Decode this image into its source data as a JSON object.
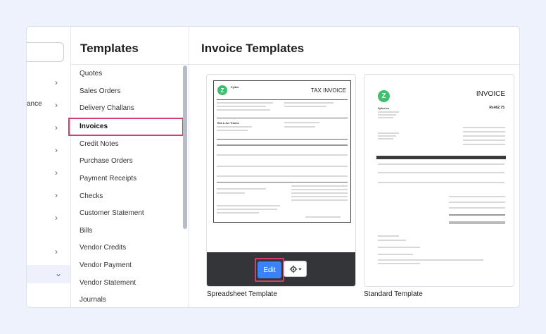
{
  "left_nav": {
    "fragment": "ance"
  },
  "templates_nav": {
    "title": "Templates",
    "items": [
      {
        "label": "Quotes"
      },
      {
        "label": "Sales Orders"
      },
      {
        "label": "Delivery Challans"
      },
      {
        "label": "Invoices"
      },
      {
        "label": "Credit Notes"
      },
      {
        "label": "Purchase Orders"
      },
      {
        "label": "Payment Receipts"
      },
      {
        "label": "Checks"
      },
      {
        "label": "Customer Statement"
      },
      {
        "label": "Bills"
      },
      {
        "label": "Vendor Credits"
      },
      {
        "label": "Vendor Payment"
      },
      {
        "label": "Vendor Statement"
      },
      {
        "label": "Journals"
      }
    ],
    "active": "Invoices"
  },
  "main": {
    "title": "Invoice Templates",
    "templates": [
      {
        "name": "Spreadsheet Template",
        "edit_label": "Edit",
        "preview": {
          "heading": "TAX INVOICE",
          "company": "Zylker",
          "bill_to": "Rob & Joe Traders",
          "logo_letter": "Z"
        }
      },
      {
        "name": "Standard Template",
        "preview": {
          "heading": "INVOICE",
          "company": "Zylker Inc",
          "balance_due": "Rs462.75",
          "logo_letter": "Z"
        }
      }
    ]
  }
}
